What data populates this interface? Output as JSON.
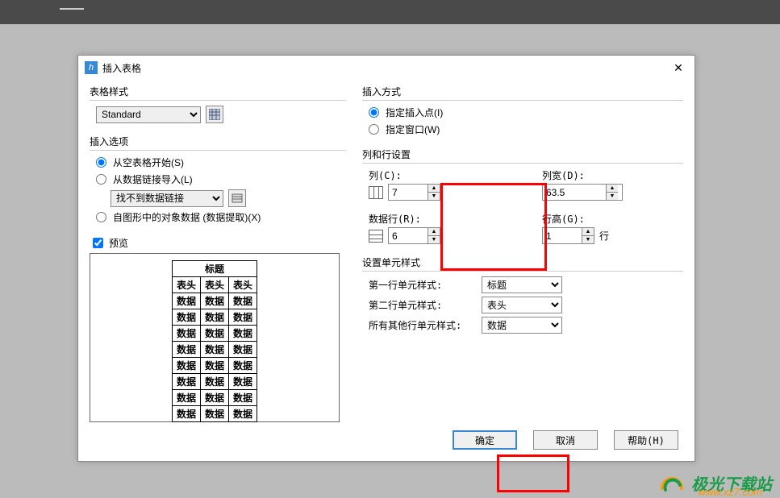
{
  "dialog": {
    "title": "插入表格"
  },
  "table_style": {
    "group_label": "表格样式",
    "select_value": "Standard"
  },
  "insert_options": {
    "group_label": "插入选项",
    "opt_blank": "从空表格开始(S)",
    "opt_link": "从数据链接导入(L)",
    "link_placeholder": "找不到数据链接",
    "opt_extract": "自图形中的对象数据 (数据提取)(X)"
  },
  "preview": {
    "checkbox_label": "预览",
    "title": "标题",
    "header": "表头",
    "data": "数据"
  },
  "insert_method": {
    "group_label": "插入方式",
    "opt_point": "指定插入点(I)",
    "opt_window": "指定窗口(W)"
  },
  "col_row": {
    "group_label": "列和行设置",
    "columns_label": "列(C):",
    "columns_value": "7",
    "col_width_label": "列宽(D):",
    "col_width_value": "63.5",
    "rows_label": "数据行(R):",
    "rows_value": "6",
    "row_height_label": "行高(G):",
    "row_height_value": "1",
    "row_unit": "行"
  },
  "cell_style": {
    "group_label": "设置单元样式",
    "first_row_label": "第一行单元样式:",
    "first_row_value": "标题",
    "second_row_label": "第二行单元样式:",
    "second_row_value": "表头",
    "other_rows_label": "所有其他行单元样式:",
    "other_rows_value": "数据"
  },
  "buttons": {
    "ok": "确定",
    "cancel": "取消",
    "help": "帮助(H)"
  },
  "watermark": {
    "text": "极光下载站",
    "url": "www.xz7.com"
  }
}
